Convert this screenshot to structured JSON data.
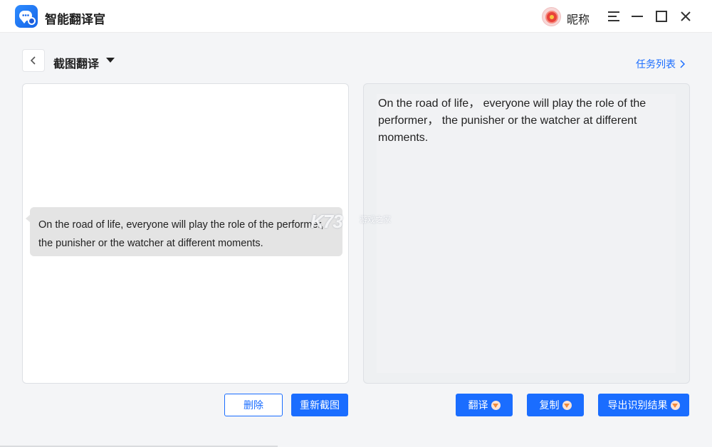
{
  "titlebar": {
    "app_title": "智能翻译官",
    "user_nickname": "昵称",
    "icons": [
      "app-logo-icon",
      "avatar-flower-icon",
      "menu-icon",
      "minimize-icon",
      "maximize-icon",
      "close-icon"
    ]
  },
  "subheader": {
    "mode_title": "截图翻译",
    "task_list_link": "任务列表"
  },
  "source_panel": {
    "screenshot_text": "On the road of life, everyone will play the role of the performer, the punisher or the watcher at different moments."
  },
  "result_panel": {
    "translated_text": "On the road of life， everyone will play the role of the performer， the punisher or the watcher at different moments."
  },
  "watermark": {
    "logo_text": "K73",
    "sub_text": "游戏之家"
  },
  "actions": {
    "delete_label": "删除",
    "recapture_label": "重新截图",
    "translate_label": "翻译",
    "copy_label": "复制",
    "export_label": "导出识别结果"
  },
  "colors": {
    "accent": "#1a6dff",
    "background": "#f4f5f7",
    "result_panel_bg": "#eef0f2",
    "bubble_bg": "#e4e4e4"
  }
}
